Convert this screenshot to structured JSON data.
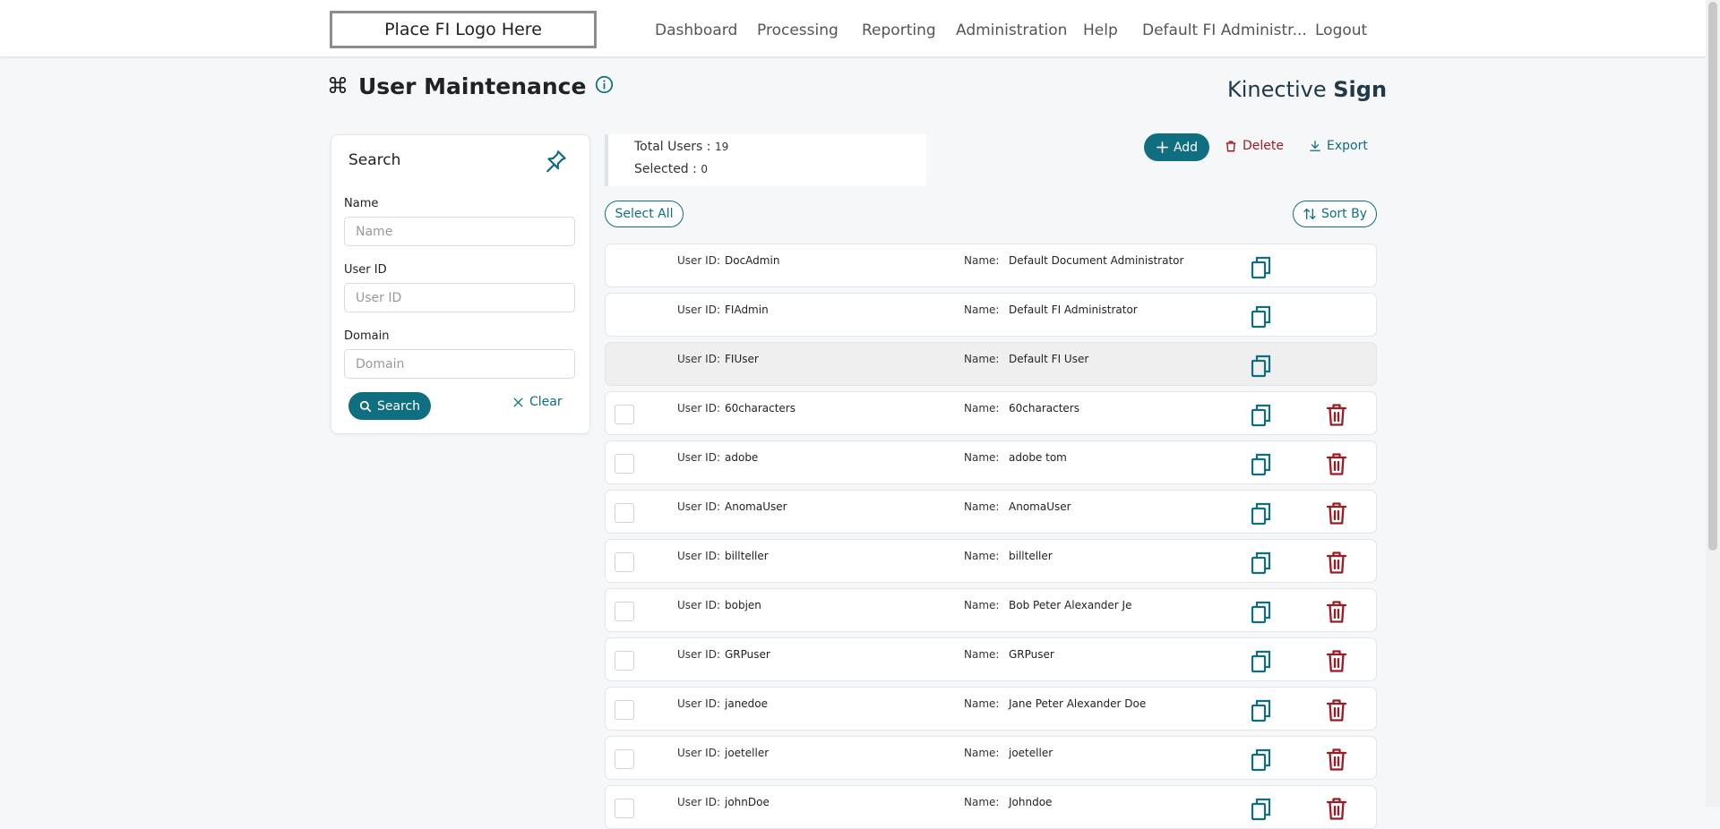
{
  "header": {
    "logo": "Place FI Logo Here",
    "nav": [
      {
        "label": "Dashboard"
      },
      {
        "label": "Processing"
      },
      {
        "label": "Reporting"
      },
      {
        "label": "Administration"
      },
      {
        "label": "Help"
      },
      {
        "label": "Default FI Administr..."
      },
      {
        "label": "Logout"
      }
    ]
  },
  "page": {
    "title": "User Maintenance",
    "brand_regular": "Kinective",
    "brand_bold": "Sign"
  },
  "search_panel": {
    "title": "Search",
    "fields": [
      {
        "label": "Name",
        "placeholder": "Name"
      },
      {
        "label": "User ID",
        "placeholder": "User ID"
      },
      {
        "label": "Domain",
        "placeholder": "Domain"
      }
    ],
    "search_label": "Search",
    "clear_label": "Clear"
  },
  "summary": {
    "total_label": "Total Users :",
    "total_value": "19",
    "selected_label": "Selected :",
    "selected_value": "0"
  },
  "toolbar": {
    "add_label": "Add",
    "delete_label": "Delete",
    "export_label": "Export",
    "select_all_label": "Select All",
    "sort_by_label": "Sort By"
  },
  "list": {
    "user_id_label": "User ID:",
    "name_label": "Name:",
    "rows": [
      {
        "user_id": "DocAdmin",
        "name": "Default Document Administrator",
        "selectable": false
      },
      {
        "user_id": "FIAdmin",
        "name": "Default FI Administrator",
        "selectable": false
      },
      {
        "user_id": "FIUser",
        "name": "Default FI User",
        "selectable": false
      },
      {
        "user_id": "60characters",
        "name": "60characters",
        "selectable": true
      },
      {
        "user_id": "adobe",
        "name": "adobe tom",
        "selectable": true
      },
      {
        "user_id": "AnomaUser",
        "name": "AnomaUser",
        "selectable": true
      },
      {
        "user_id": "billteller",
        "name": "billteller",
        "selectable": true
      },
      {
        "user_id": "bobjen",
        "name": "Bob Peter Alexander Je",
        "selectable": true
      },
      {
        "user_id": "GRPuser",
        "name": "GRPuser",
        "selectable": true
      },
      {
        "user_id": "janedoe",
        "name": "Jane Peter Alexander Doe",
        "selectable": true
      },
      {
        "user_id": "joeteller",
        "name": "joeteller",
        "selectable": true
      },
      {
        "user_id": "johnDoe",
        "name": "Johndoe",
        "selectable": true
      }
    ]
  },
  "colors": {
    "accent": "#0f6e7f",
    "danger": "#9b1c24",
    "page_bg": "#f6f7f9"
  }
}
